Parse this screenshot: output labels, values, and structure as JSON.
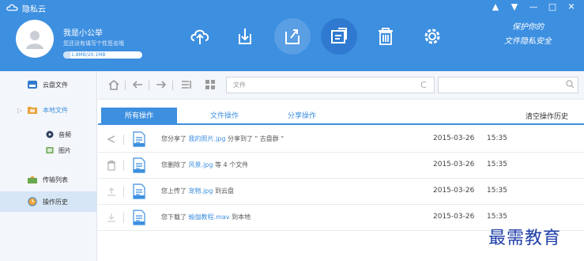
{
  "app": {
    "title": "隐私云",
    "logo_icon": "cloud-logo-icon"
  },
  "window_controls": {
    "user": "▲",
    "menu": "▼",
    "minimize": "—",
    "maximize": "□",
    "close": "✕"
  },
  "user": {
    "name": "我是小公举",
    "signature": "您还没有填写个性签名哦",
    "quota_text": "1.8MB/20.1MB",
    "quota_fraction": 0.09
  },
  "toolbar_icons": [
    "upload-cloud-icon",
    "download-icon",
    "share-icon",
    "history-icon",
    "trash-icon",
    "settings-icon"
  ],
  "slogan": {
    "line1": "保护你的",
    "line2": "文件隐私安全"
  },
  "sidebar": {
    "items": [
      {
        "label": "云盘文件",
        "icon": "cloud-disk-icon"
      },
      {
        "label": "本地文件",
        "icon": "folder-icon"
      },
      {
        "label": "传输列表",
        "icon": "transfer-icon"
      },
      {
        "label": "操作历史",
        "icon": "clock-icon"
      }
    ],
    "sub_items": [
      {
        "label": "音频",
        "icon": "audio-icon"
      },
      {
        "label": "图片",
        "icon": "image-icon"
      }
    ],
    "expand_arrow": "▷"
  },
  "nav": {
    "path_placeholder": "文件",
    "search_placeholder": ""
  },
  "tabs": [
    {
      "label": "所有操作"
    },
    {
      "label": "文件操作"
    },
    {
      "label": "分享操作"
    }
  ],
  "clear_history": "清空操作历史",
  "history": [
    {
      "icon": "share-icon",
      "prefix": "您分享了",
      "file": "我的照片.jpg",
      "suffix": "分享到了 \" 古盘群 \"",
      "date": "2015-03-26",
      "time": "15:35"
    },
    {
      "icon": "trash-icon",
      "prefix": "您删除了",
      "file": "风景.jpg",
      "suffix": "等 4 个文件",
      "date": "2015-03-26",
      "time": "15:35"
    },
    {
      "icon": "upload-icon",
      "prefix": "您上传了",
      "file": "宠物.jpg",
      "suffix": "到云盘",
      "date": "2015-03-26",
      "time": "15:35"
    },
    {
      "icon": "download-icon",
      "prefix": "您下载了",
      "file": "瑜伽教程.mav",
      "suffix": "到本地",
      "date": "2015-03-26",
      "time": "15:35"
    }
  ],
  "watermark": "最需教育",
  "colors": {
    "brand": "#3d8fe0",
    "sidebar_bg": "#f3f6fa",
    "active_bg": "#d6e6f6",
    "watermark": "#1f3fa8"
  }
}
